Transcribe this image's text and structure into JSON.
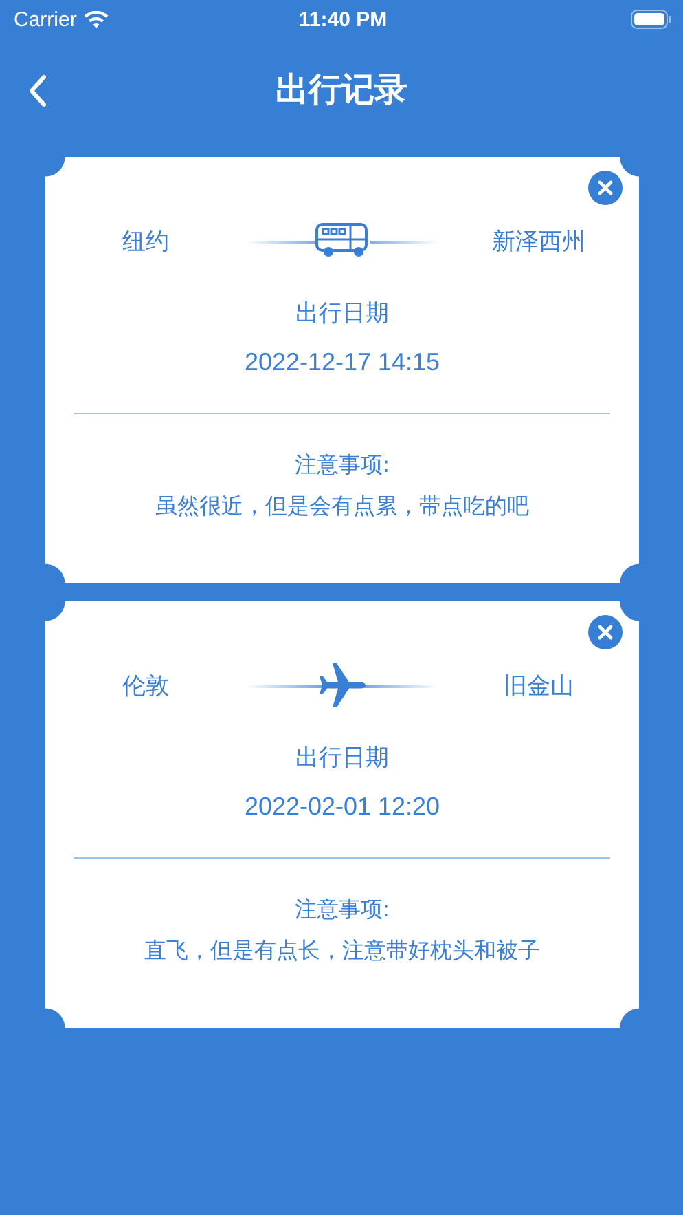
{
  "status_bar": {
    "carrier": "Carrier",
    "time": "11:40 PM"
  },
  "nav": {
    "title": "出行记录"
  },
  "trips": [
    {
      "from": "纽约",
      "to": "新泽西州",
      "kind": "bus",
      "date_label": "出行日期",
      "date": "2022-12-17 14:15",
      "notes_label": "注意事项:",
      "notes": "虽然很近，但是会有点累，带点吃的吧"
    },
    {
      "from": "伦敦",
      "to": "旧金山",
      "kind": "plane",
      "date_label": "出行日期",
      "date": "2022-02-01 12:20",
      "notes_label": "注意事项:",
      "notes": "直飞，但是有点长，注意带好枕头和被子"
    }
  ]
}
